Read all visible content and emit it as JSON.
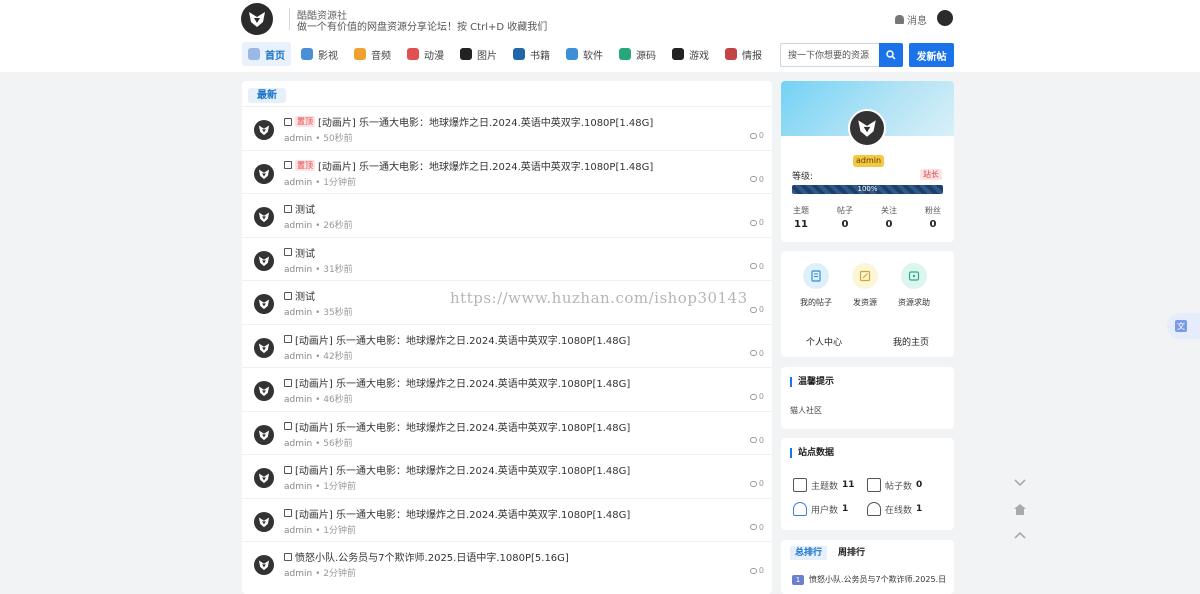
{
  "header": {
    "site_name": "酷酷资源社",
    "slogan": "做一个有价值的网盘资源分享论坛！按 Ctrl+D 收藏我们",
    "messages_label": "消息",
    "search_placeholder": "搜一下你想要的资源",
    "post_button": "发新帖"
  },
  "nav": [
    {
      "label": "首页",
      "color": "#9ab7e6",
      "active": true
    },
    {
      "label": "影视",
      "color": "#4a90d9"
    },
    {
      "label": "音频",
      "color": "#f0a030"
    },
    {
      "label": "动漫",
      "color": "#e05050"
    },
    {
      "label": "图片",
      "color": "#222222"
    },
    {
      "label": "书籍",
      "color": "#2266aa"
    },
    {
      "label": "软件",
      "color": "#3c8fd8"
    },
    {
      "label": "源码",
      "color": "#28a87a"
    },
    {
      "label": "游戏",
      "color": "#222222"
    },
    {
      "label": "情报",
      "color": "#c24444"
    }
  ],
  "main": {
    "tab_label": "最新",
    "posts": [
      {
        "top": true,
        "top_label": "置顶",
        "title": "[动画片] 乐一通大电影：地球爆炸之日.2024.英语中英双字.1080P[1.48G]",
        "author": "admin",
        "time": "50秒前",
        "comments": "0"
      },
      {
        "top": true,
        "top_label": "置顶",
        "title": "[动画片] 乐一通大电影：地球爆炸之日.2024.英语中英双字.1080P[1.48G]",
        "author": "admin",
        "time": "1分钟前",
        "comments": "0"
      },
      {
        "top": false,
        "title": "测试",
        "author": "admin",
        "time": "26秒前",
        "comments": "0"
      },
      {
        "top": false,
        "title": "测试",
        "author": "admin",
        "time": "31秒前",
        "comments": "0"
      },
      {
        "top": false,
        "title": "测试",
        "author": "admin",
        "time": "35秒前",
        "comments": "0"
      },
      {
        "top": false,
        "title": "[动画片] 乐一通大电影：地球爆炸之日.2024.英语中英双字.1080P[1.48G]",
        "author": "admin",
        "time": "42秒前",
        "comments": "0"
      },
      {
        "top": false,
        "title": "[动画片] 乐一通大电影：地球爆炸之日.2024.英语中英双字.1080P[1.48G]",
        "author": "admin",
        "time": "46秒前",
        "comments": "0"
      },
      {
        "top": false,
        "title": "[动画片] 乐一通大电影：地球爆炸之日.2024.英语中英双字.1080P[1.48G]",
        "author": "admin",
        "time": "56秒前",
        "comments": "0"
      },
      {
        "top": false,
        "title": "[动画片] 乐一通大电影：地球爆炸之日.2024.英语中英双字.1080P[1.48G]",
        "author": "admin",
        "time": "1分钟前",
        "comments": "0"
      },
      {
        "top": false,
        "title": "[动画片] 乐一通大电影：地球爆炸之日.2024.英语中英双字.1080P[1.48G]",
        "author": "admin",
        "time": "1分钟前",
        "comments": "0"
      },
      {
        "top": false,
        "title": "愤怒小队.公务员与7个欺诈师.2025.日语中字.1080P[5.16G]",
        "author": "admin",
        "time": "2分钟前",
        "comments": "0"
      }
    ]
  },
  "profile": {
    "username": "admin",
    "level_label": "等级:",
    "role": "站长",
    "level_percent": 100,
    "level_text": "100%",
    "stats": [
      {
        "label": "主题",
        "value": "11"
      },
      {
        "label": "帖子",
        "value": "0"
      },
      {
        "label": "关注",
        "value": "0"
      },
      {
        "label": "粉丝",
        "value": "0"
      }
    ]
  },
  "quick": {
    "items": [
      {
        "label": "我的帖子",
        "bg": "#dff0fb",
        "fg": "#2a8fd4"
      },
      {
        "label": "发资源",
        "bg": "#fbf6d8",
        "fg": "#d4a52a"
      },
      {
        "label": "资源求助",
        "bg": "#dcf5ef",
        "fg": "#2aae8a"
      }
    ],
    "links": [
      "个人中心",
      "我的主页"
    ]
  },
  "notice": {
    "title": "温馨提示",
    "body": "猫人社区"
  },
  "site_stats": {
    "title": "站点数据",
    "items": [
      {
        "label": "主题数",
        "value": "11"
      },
      {
        "label": "帖子数",
        "value": "0"
      },
      {
        "label": "用户数",
        "value": "1"
      },
      {
        "label": "在线数",
        "value": "1"
      }
    ]
  },
  "ranking": {
    "tabs": [
      "总排行",
      "周排行"
    ],
    "items": [
      {
        "rank": "1",
        "title": "愤怒小队.公务员与7个欺诈师.2025.日"
      }
    ]
  },
  "watermark": "https://www.huzhan.com/ishop30143",
  "colors": {
    "accent": "#1a73e8",
    "tag_red": "#e04545"
  }
}
